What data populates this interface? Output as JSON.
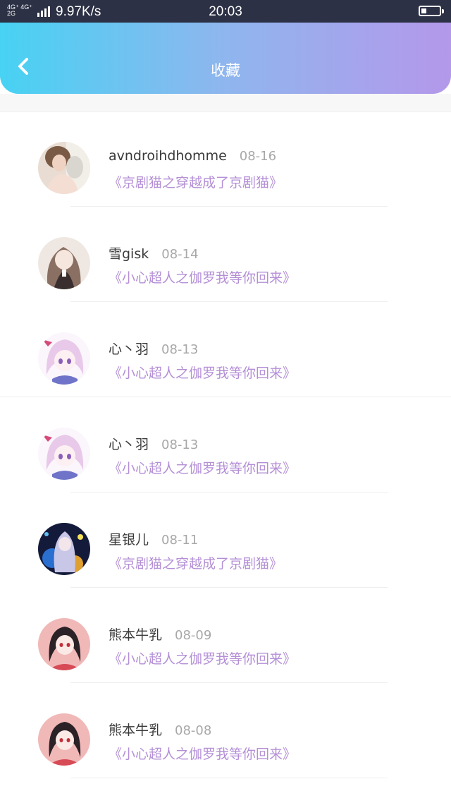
{
  "status_bar": {
    "net_top": "4G⁺ 4G⁺",
    "net_bottom": "2G",
    "speed": "9.97K/s",
    "time": "20:03"
  },
  "header": {
    "title": "收藏",
    "back_icon": "chevron-left-icon"
  },
  "colors": {
    "gradient_start": "#47d2f3",
    "gradient_end": "#b498ea",
    "book_title": "#b48fd6",
    "name": "#3a3a3a",
    "date": "#a8a8a8"
  },
  "favorites": [
    {
      "name": "avndroihdhomme",
      "date": "08-16",
      "book": "《京剧猫之穿越成了京剧猫》"
    },
    {
      "name": "雪gisk",
      "date": "08-14",
      "book": "《小心超人之伽罗我等你回来》"
    },
    {
      "name": "心丶羽",
      "date": "08-13",
      "book": "《小心超人之伽罗我等你回来》"
    },
    {
      "name": "心丶羽",
      "date": "08-13",
      "book": "《小心超人之伽罗我等你回来》"
    },
    {
      "name": "星银儿",
      "date": "08-11",
      "book": "《京剧猫之穿越成了京剧猫》"
    },
    {
      "name": "熊本牛乳",
      "date": "08-09",
      "book": "《小心超人之伽罗我等你回来》"
    },
    {
      "name": "熊本牛乳",
      "date": "08-08",
      "book": "《小心超人之伽罗我等你回来》"
    }
  ]
}
